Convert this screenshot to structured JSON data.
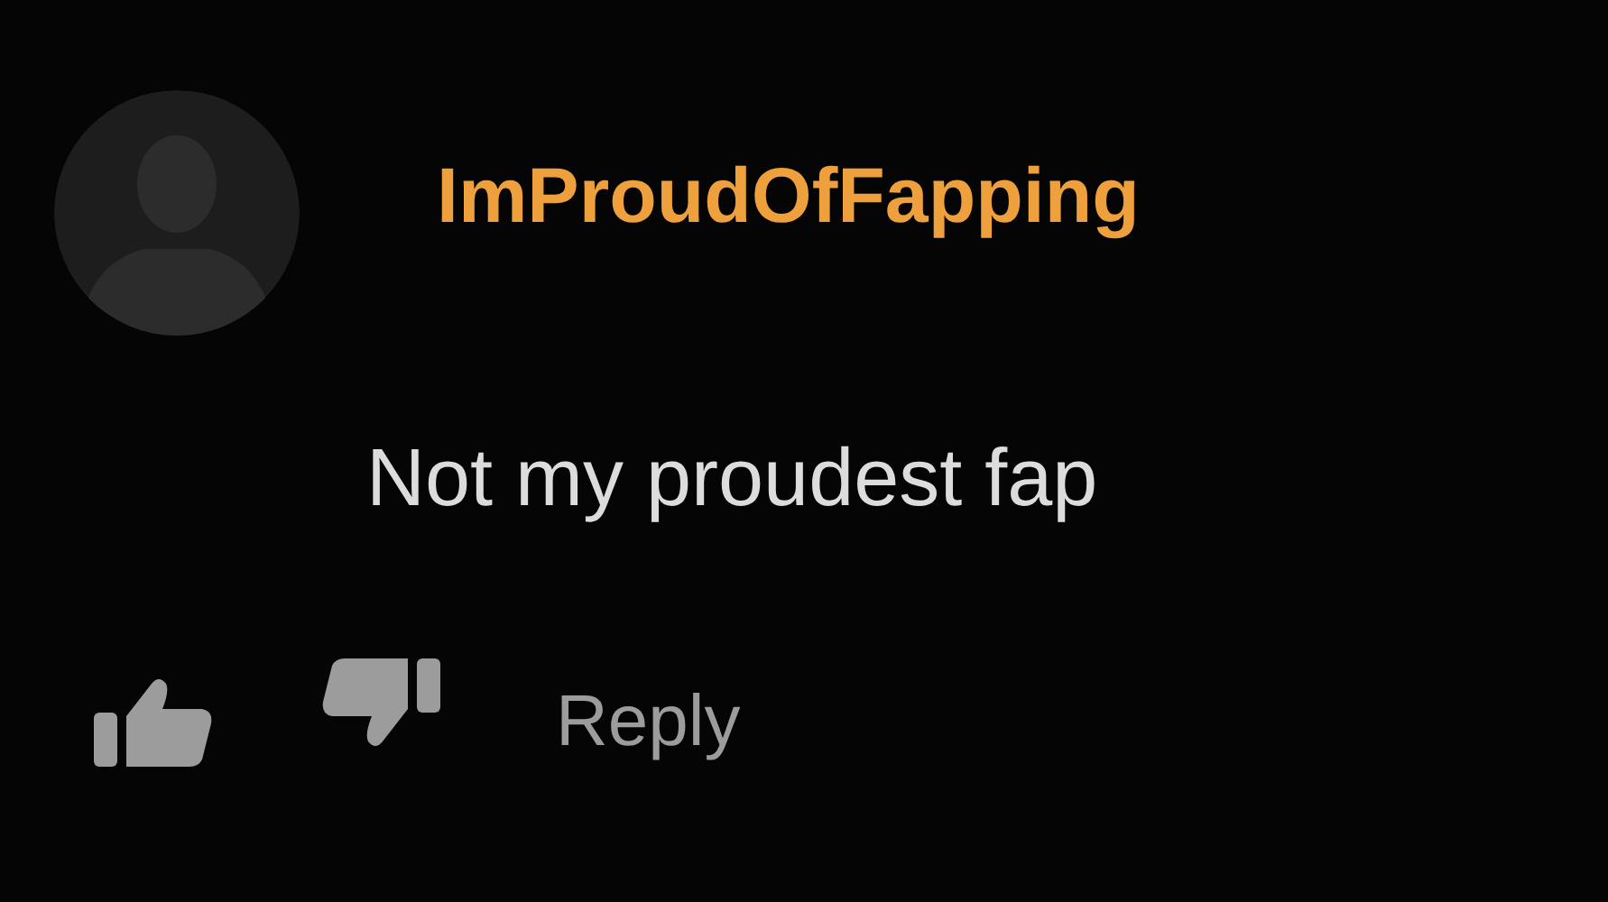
{
  "comment": {
    "username": "ImProudOfFapping",
    "text": "Not my proudest fap"
  },
  "actions": {
    "reply": "Reply"
  }
}
